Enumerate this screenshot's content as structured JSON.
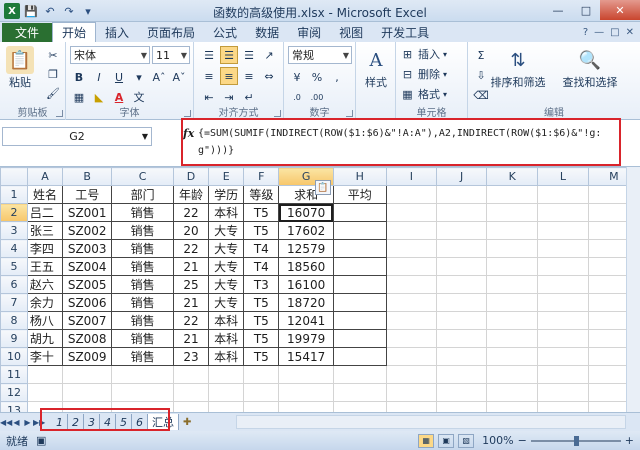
{
  "title": "函数的高级使用.xlsx - Microsoft Excel",
  "tabs": {
    "file": "文件",
    "items": [
      "开始",
      "插入",
      "页面布局",
      "公式",
      "数据",
      "审阅",
      "视图",
      "开发工具"
    ]
  },
  "ribbon": {
    "paste": "粘贴",
    "clipboard_label": "剪贴板",
    "font_name": "宋体",
    "font_size": "11",
    "font_label": "字体",
    "align_label": "对齐方式",
    "number_format": "常规",
    "number_label": "数字",
    "styles": "样式",
    "insert": "插入",
    "delete": "删除",
    "format": "格式",
    "cells_label": "单元格",
    "sort_filter": "排序和筛选",
    "find_select": "查找和选择",
    "edit_label": "编辑"
  },
  "formula_bar": {
    "name_box": "G2",
    "fx": "fx",
    "formula": "{=SUM(SUMIF(INDIRECT(ROW($1:$6)&\"!A:A\"),A2,INDIRECT(ROW($1:$6)&\"!g:g\")))}"
  },
  "grid": {
    "columns": [
      "A",
      "B",
      "C",
      "D",
      "E",
      "F",
      "G",
      "H",
      "I",
      "J",
      "K",
      "L",
      "M"
    ],
    "rows": [
      "1",
      "2",
      "3",
      "4",
      "5",
      "6",
      "7",
      "8",
      "9",
      "10",
      "11",
      "12",
      "13"
    ],
    "header": [
      "姓名",
      "工号",
      "部门",
      "年龄",
      "学历",
      "等级",
      "求和",
      "平均"
    ],
    "data": [
      [
        "吕二",
        "SZ001",
        "销售",
        "22",
        "本科",
        "T5",
        "16070"
      ],
      [
        "张三",
        "SZ002",
        "销售",
        "20",
        "大专",
        "T5",
        "17602"
      ],
      [
        "李四",
        "SZ003",
        "销售",
        "22",
        "大专",
        "T4",
        "12579"
      ],
      [
        "王五",
        "SZ004",
        "销售",
        "21",
        "大专",
        "T4",
        "18560"
      ],
      [
        "赵六",
        "SZ005",
        "销售",
        "25",
        "大专",
        "T3",
        "16100"
      ],
      [
        "余力",
        "SZ006",
        "销售",
        "21",
        "大专",
        "T5",
        "18720"
      ],
      [
        "杨八",
        "SZ007",
        "销售",
        "22",
        "本科",
        "T5",
        "12041"
      ],
      [
        "胡九",
        "SZ008",
        "销售",
        "21",
        "本科",
        "T5",
        "19979"
      ],
      [
        "李十",
        "SZ009",
        "销售",
        "23",
        "本科",
        "T5",
        "15417"
      ]
    ]
  },
  "sheets": [
    "1",
    "2",
    "3",
    "4",
    "5",
    "6",
    "汇总"
  ],
  "status": {
    "ready": "就绪",
    "zoom": "100%"
  }
}
